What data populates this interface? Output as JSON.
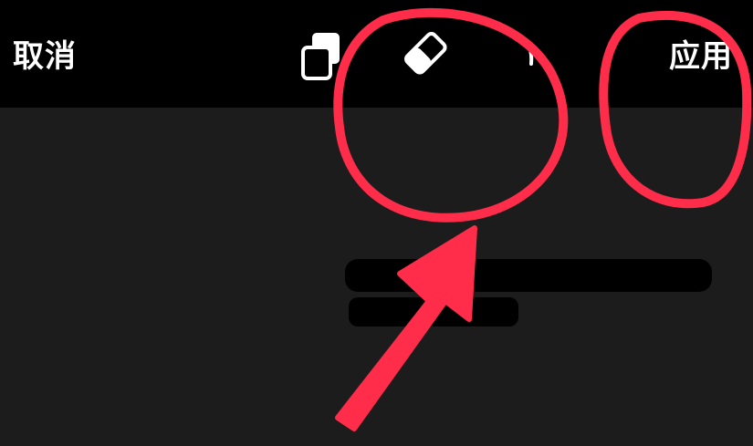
{
  "toolbar": {
    "cancel_label": "取消",
    "apply_label": "应用",
    "tools": [
      {
        "icon": "copy-layers-icon"
      },
      {
        "icon": "eraser-icon"
      },
      {
        "icon": "partial-icon"
      }
    ]
  },
  "colors": {
    "toolbar_bg": "#000000",
    "canvas_bg": "#1c1c1c",
    "annotation": "#ff2d4a",
    "text": "#ffffff"
  }
}
